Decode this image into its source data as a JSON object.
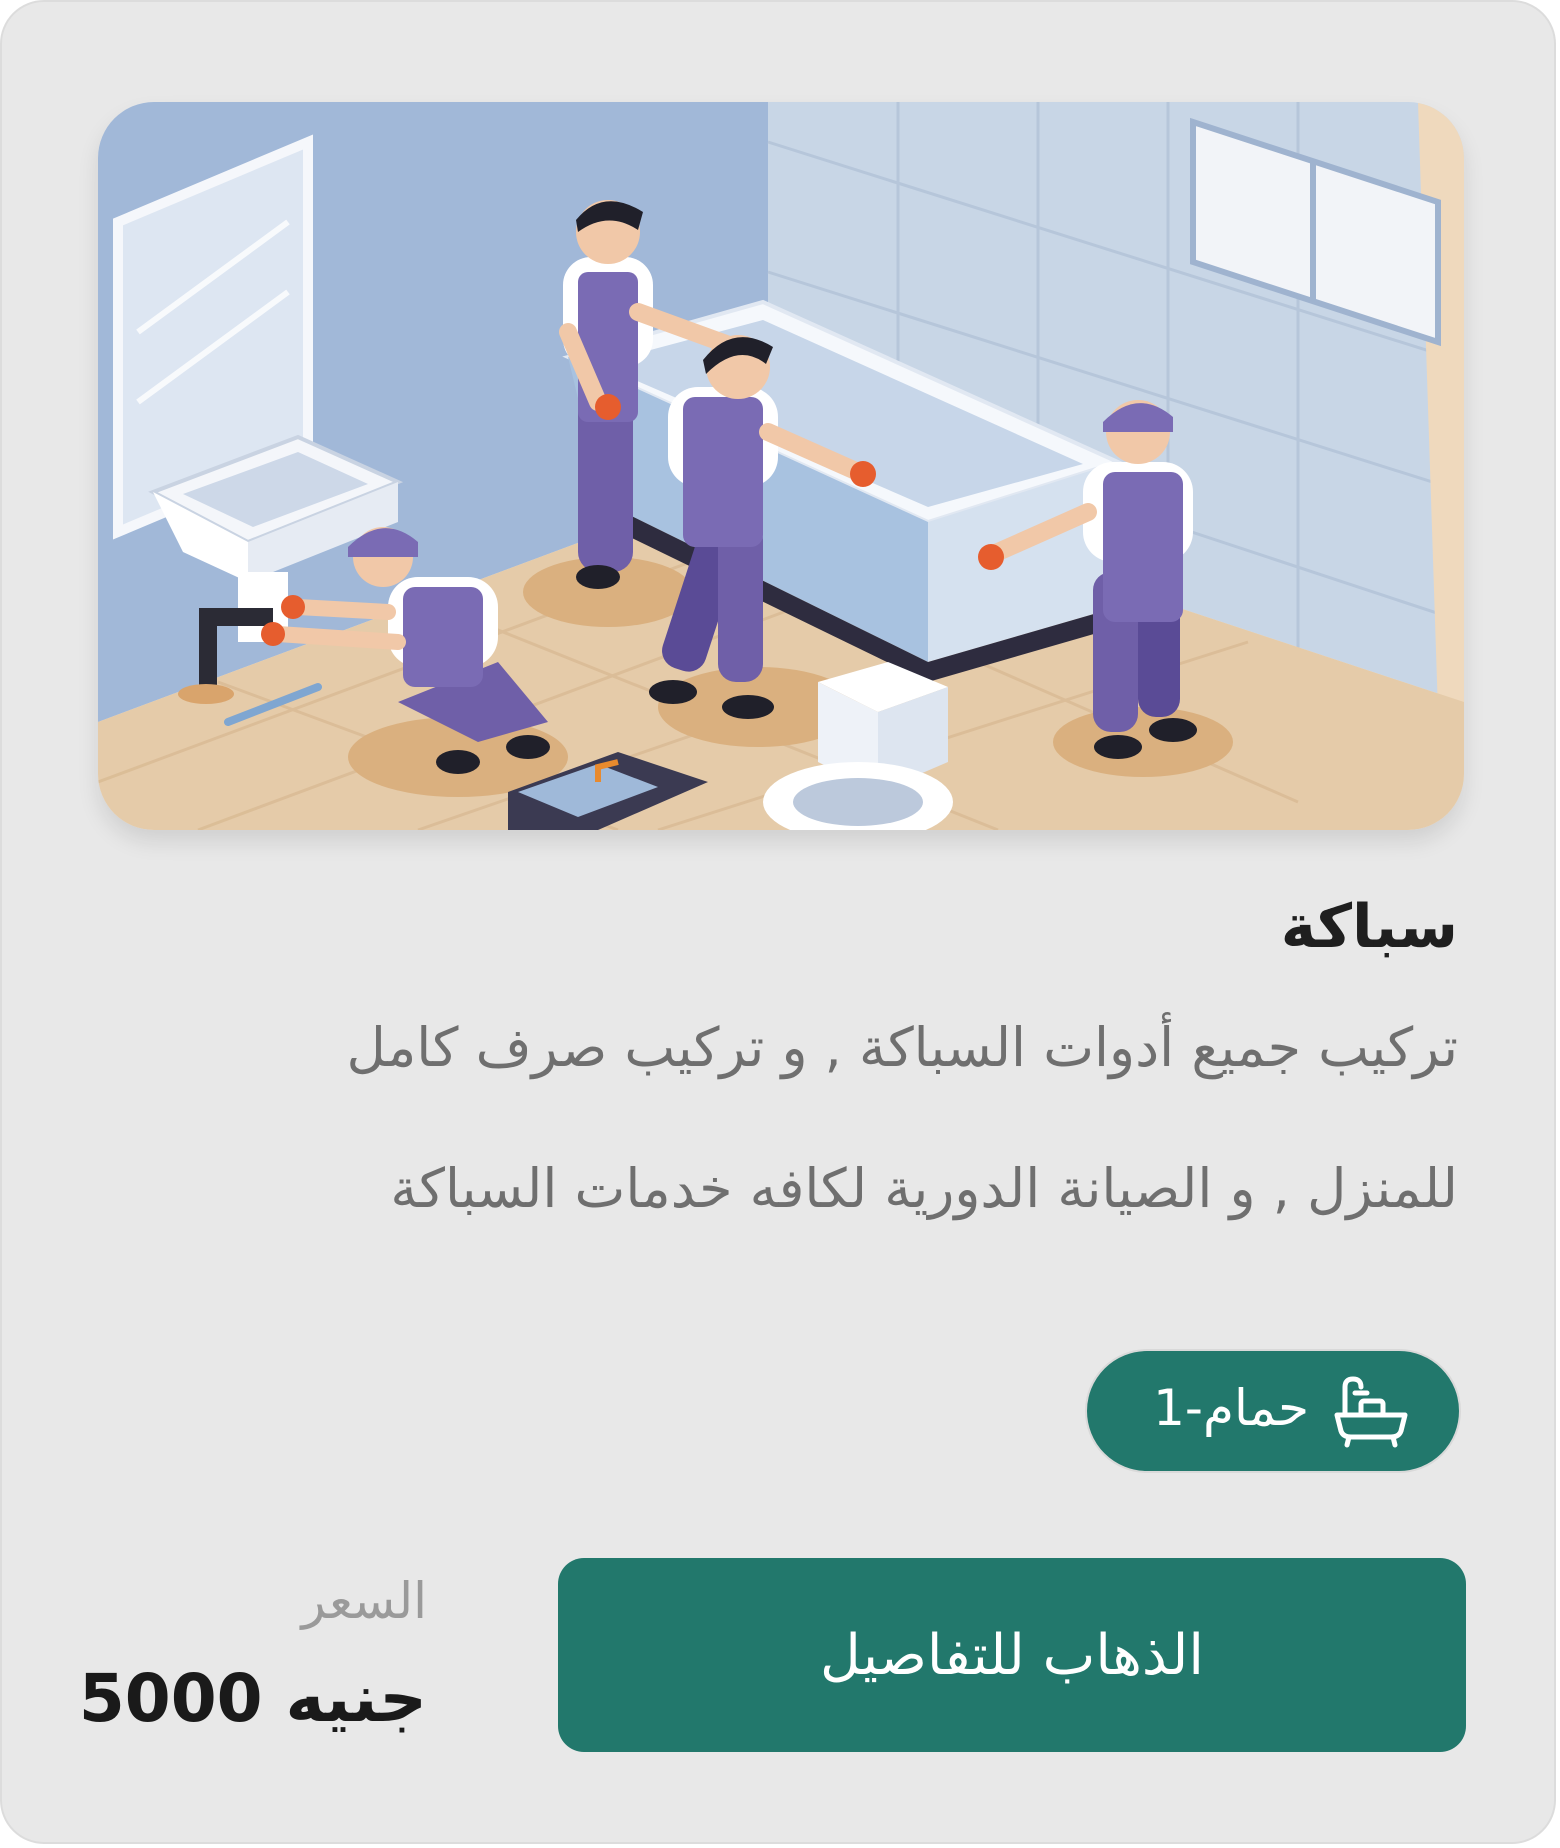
{
  "service": {
    "title": "سباكة",
    "description_lines": [
      "تركيب جميع أدوات السباكة , و تركيب صرف كامل",
      "للمنزل , و الصيانة الدورية لكافه خدمات السباكة"
    ],
    "image_icon": "plumbers-installing-bathtub-illustration"
  },
  "badge": {
    "label": "1-حمام",
    "icon": "bathtub-icon"
  },
  "price": {
    "label": "السعر",
    "value": "5000 جنيه"
  },
  "cta": {
    "label": "الذهاب للتفاصيل"
  },
  "colors": {
    "card_bg": "#e8e8e8",
    "accent": "#22786c",
    "title_text": "#1f1f1f",
    "body_text": "#6f6f6f",
    "muted_text": "#9a9a9a"
  }
}
